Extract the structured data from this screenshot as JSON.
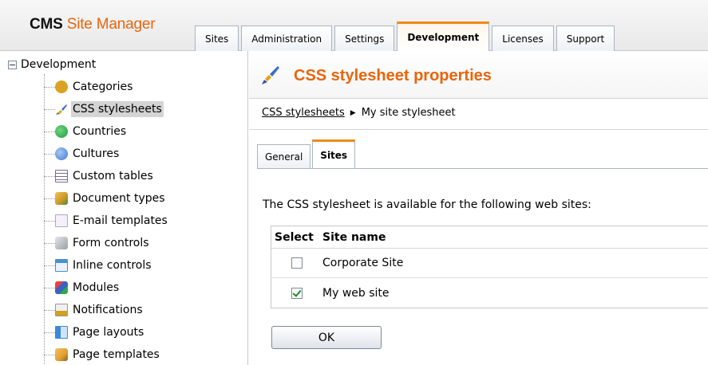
{
  "app": {
    "brand": "CMS",
    "product": "Site Manager"
  },
  "top_tabs": [
    {
      "label": "Sites"
    },
    {
      "label": "Administration"
    },
    {
      "label": "Settings"
    },
    {
      "label": "Development",
      "active": true
    },
    {
      "label": "Licenses"
    },
    {
      "label": "Support"
    }
  ],
  "tree": {
    "root": "Development",
    "items": [
      {
        "label": "Categories",
        "icon": "categories-icon",
        "color": "#d9a321"
      },
      {
        "label": "CSS stylesheets",
        "icon": "brush-icon",
        "color": "#3a6cc8",
        "selected": true
      },
      {
        "label": "Countries",
        "icon": "globe-icon",
        "color": "#1f9a3d"
      },
      {
        "label": "Cultures",
        "icon": "culture-globe-icon",
        "color": "#3d7ad6"
      },
      {
        "label": "Custom tables",
        "icon": "table-icon",
        "color": "#7a6a9a"
      },
      {
        "label": "Document types",
        "icon": "document-types-icon",
        "color": "#c9982a"
      },
      {
        "label": "E-mail templates",
        "icon": "envelope-icon",
        "color": "#b0a8c8"
      },
      {
        "label": "Form controls",
        "icon": "form-controls-icon",
        "color": "#9aa0a6"
      },
      {
        "label": "Inline controls",
        "icon": "inline-controls-icon",
        "color": "#4a90d0"
      },
      {
        "label": "Modules",
        "icon": "modules-icon",
        "color": "#3a62c0"
      },
      {
        "label": "Notifications",
        "icon": "notifications-icon",
        "color": "#d0a020"
      },
      {
        "label": "Page layouts",
        "icon": "page-layouts-icon",
        "color": "#3a8ad8"
      },
      {
        "label": "Page templates",
        "icon": "page-templates-icon",
        "color": "#e0a030"
      }
    ]
  },
  "main": {
    "title": "CSS stylesheet properties",
    "breadcrumb": {
      "link": "CSS stylesheets",
      "current": "My site stylesheet"
    },
    "subtabs": [
      {
        "label": "General"
      },
      {
        "label": "Sites",
        "active": true
      }
    ],
    "description": "The CSS stylesheet is available for the following web sites:",
    "grid": {
      "headers": [
        "Select",
        "Site name"
      ],
      "rows": [
        {
          "site": "Corporate Site",
          "checked": false
        },
        {
          "site": "My web site",
          "checked": true
        }
      ]
    },
    "ok_label": "OK"
  },
  "colors": {
    "accent": "#e8650c",
    "tab_highlight": "#f08a1a"
  }
}
